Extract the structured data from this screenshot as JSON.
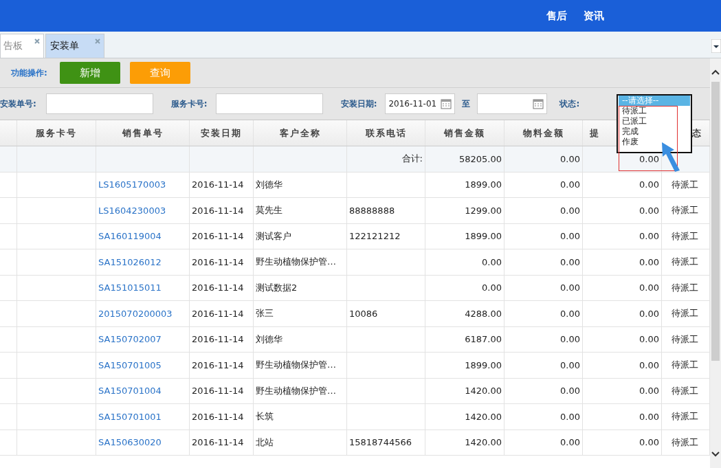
{
  "top_nav": {
    "items": [
      "售后",
      "资讯"
    ]
  },
  "tabs": [
    {
      "label": "告板",
      "selected": false
    },
    {
      "label": "安装单",
      "selected": true
    }
  ],
  "toolbar": {
    "label": "功能操作:",
    "buttons": [
      {
        "label": "新增",
        "kind": "add"
      },
      {
        "label": "查询",
        "kind": "query"
      }
    ]
  },
  "filters": {
    "install_no": {
      "label": "安装单号:"
    },
    "card_no": {
      "label": "服务卡号:"
    },
    "date": {
      "label": "安装日期:",
      "from": "2016-11-01",
      "to_label": "至"
    },
    "status": {
      "label": "状态:",
      "options": [
        {
          "label": "--请选择--",
          "selected": true
        },
        {
          "label": "待派工",
          "selected": false
        },
        {
          "label": "已派工",
          "selected": false
        },
        {
          "label": "完成",
          "selected": false
        },
        {
          "label": "作废",
          "selected": false
        }
      ]
    }
  },
  "table": {
    "columns": [
      "",
      "服务卡号",
      "销售单号",
      "安装日期",
      "客户全称",
      "联系电话",
      "销售金额",
      "物料金额",
      "提",
      "态"
    ],
    "total": {
      "label": "合计:",
      "sales": "58205.00",
      "material": "0.00",
      "commission": "0.00"
    },
    "rows": [
      {
        "order": "LS1605170003",
        "date": "2016-11-14",
        "customer": "刘德华",
        "phone": "",
        "sales": "1899.00",
        "material": "0.00",
        "commission": "0.00",
        "status": "待派工"
      },
      {
        "order": "LS1604230003",
        "date": "2016-11-14",
        "customer": "莫先生",
        "phone": "88888888",
        "sales": "1299.00",
        "material": "0.00",
        "commission": "0.00",
        "status": "待派工"
      },
      {
        "order": "SA160119004",
        "date": "2016-11-14",
        "customer": "测试客户",
        "phone": "122121212",
        "sales": "1899.00",
        "material": "0.00",
        "commission": "0.00",
        "status": "待派工"
      },
      {
        "order": "SA151026012",
        "date": "2016-11-14",
        "customer": "野生动植物保护管…",
        "phone": "",
        "sales": "0.00",
        "material": "0.00",
        "commission": "0.00",
        "status": "待派工"
      },
      {
        "order": "SA151015011",
        "date": "2016-11-14",
        "customer": "测试数据2",
        "phone": "",
        "sales": "0.00",
        "material": "0.00",
        "commission": "0.00",
        "status": "待派工"
      },
      {
        "order": "2015070200003",
        "date": "2016-11-14",
        "customer": "张三",
        "phone": "10086",
        "sales": "4288.00",
        "material": "0.00",
        "commission": "0.00",
        "status": "待派工"
      },
      {
        "order": "SA150702007",
        "date": "2016-11-14",
        "customer": "刘德华",
        "phone": "",
        "sales": "6187.00",
        "material": "0.00",
        "commission": "0.00",
        "status": "待派工"
      },
      {
        "order": "SA150701005",
        "date": "2016-11-14",
        "customer": "野生动植物保护管…",
        "phone": "",
        "sales": "1899.00",
        "material": "0.00",
        "commission": "0.00",
        "status": "待派工"
      },
      {
        "order": "SA150701004",
        "date": "2016-11-14",
        "customer": "野生动植物保护管…",
        "phone": "",
        "sales": "1420.00",
        "material": "0.00",
        "commission": "0.00",
        "status": "待派工"
      },
      {
        "order": "SA150701001",
        "date": "2016-11-14",
        "customer": "长筑",
        "phone": "",
        "sales": "1420.00",
        "material": "0.00",
        "commission": "0.00",
        "status": "待派工"
      },
      {
        "order": "SA150630020",
        "date": "2016-11-14",
        "customer": "北站",
        "phone": "15818744566",
        "sales": "1420.00",
        "material": "0.00",
        "commission": "0.00",
        "status": "待派工"
      }
    ]
  }
}
